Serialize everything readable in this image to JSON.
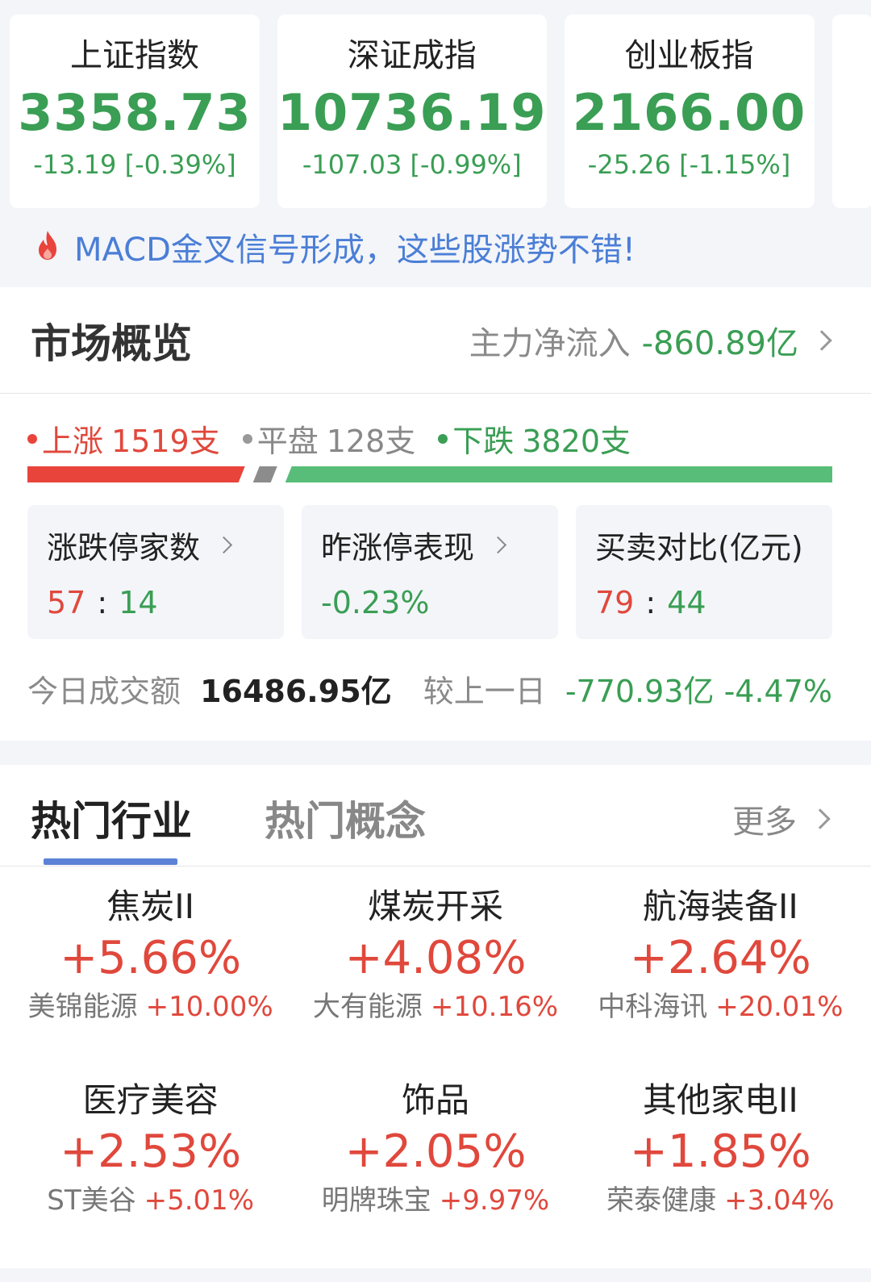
{
  "indices": [
    {
      "name": "上证指数",
      "value": "3358.73",
      "change": "-13.19 [-0.39%]"
    },
    {
      "name": "深证成指",
      "value": "10736.19",
      "change": "-107.03 [-0.99%]"
    },
    {
      "name": "创业板指",
      "value": "2166.00",
      "change": "-25.26 [-1.15%]"
    }
  ],
  "promo": {
    "icon": "flame-icon",
    "text": "MACD金叉信号形成，这些股涨势不错!"
  },
  "overview": {
    "title": "市场概览",
    "flow_label": "主力净流入",
    "flow_value": "-860.89亿",
    "up_label": "上涨",
    "up_count": "1519支",
    "flat_label": "平盘",
    "flat_count": "128支",
    "down_label": "下跌",
    "down_count": "3820支",
    "ratio": {
      "up": 1519,
      "flat": 128,
      "down": 3820
    },
    "colors": {
      "up": "#e8443c",
      "flat": "#8c8c8c",
      "down": "#58bd78"
    },
    "stats": [
      {
        "title": "涨跌停家数",
        "left": "57",
        "right": "14",
        "has_chevron": true
      },
      {
        "title": "昨涨停表现",
        "value": "-0.23%",
        "has_chevron": true
      },
      {
        "title": "买卖对比(亿元)",
        "left": "79",
        "right": "44",
        "has_chevron": false
      }
    ],
    "volume_label": "今日成交额",
    "volume_value": "16486.95亿",
    "compare_label": "较上一日",
    "compare_value": "-770.93亿 -4.47%"
  },
  "hot": {
    "tabs": [
      "热门行业",
      "热门概念"
    ],
    "more": "更多",
    "sectors": [
      {
        "name": "焦炭II",
        "pct": "+5.66%",
        "stock": "美锦能源",
        "stock_pct": "+10.00%"
      },
      {
        "name": "煤炭开采",
        "pct": "+4.08%",
        "stock": "大有能源",
        "stock_pct": "+10.16%"
      },
      {
        "name": "航海装备II",
        "pct": "+2.64%",
        "stock": "中科海讯",
        "stock_pct": "+20.01%"
      },
      {
        "name": "医疗美容",
        "pct": "+2.53%",
        "stock": "ST美谷",
        "stock_pct": "+5.01%"
      },
      {
        "name": "饰品",
        "pct": "+2.05%",
        "stock": "明牌珠宝",
        "stock_pct": "+9.97%"
      },
      {
        "name": "其他家电II",
        "pct": "+1.85%",
        "stock": "荣泰健康",
        "stock_pct": "+3.04%"
      }
    ]
  }
}
